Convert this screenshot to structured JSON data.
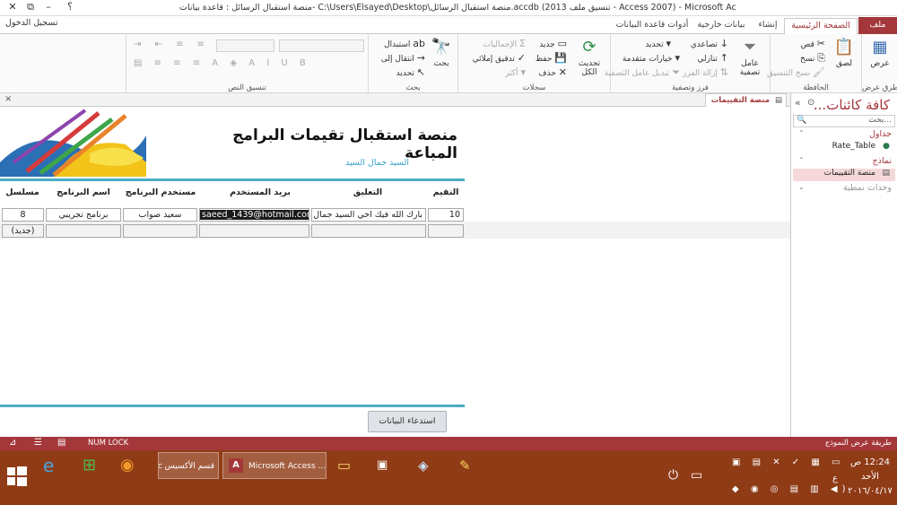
{
  "window": {
    "title": "منصة استقبال الرسائل : قاعدة بيانات- C:\\Users\\Elsayed\\Desktop\\منصة استقبال الرسائل.accdb (تنسيق ملف 2013 - Access 2007) - Microsoft Access",
    "help": "؟",
    "minimize": "–",
    "restore": "⧉",
    "close": "✕"
  },
  "signin": "تسجيل الدخول",
  "tabs": {
    "file": "ملف",
    "home": "الصفحة الرئيسية",
    "create": "إنشاء",
    "external": "بيانات خارجية",
    "dbtools": "أدوات قاعدة البيانات"
  },
  "ribbon": {
    "views": {
      "label": "طرق عرض",
      "view": "عرض"
    },
    "clipboard": {
      "label": "الحافظة",
      "paste": "لصق",
      "cut": "قص",
      "copy": "نسخ",
      "format_painter": "نسخ التنسيق"
    },
    "sort": {
      "label": "فرز وتصفية",
      "filter": "عامل تصفية",
      "asc": "تصاعدي",
      "desc": "تنازلي",
      "remove_sort": "إزالة الفرز",
      "selection": "تحديد",
      "advanced": "خيارات متقدمة",
      "toggle_filter": "تبديل عامل التصفية"
    },
    "records": {
      "label": "سجلات",
      "refresh": "تحديث الكل",
      "new": "جديد",
      "save": "حفظ",
      "delete": "حذف",
      "totals": "الإجماليات",
      "spelling": "تدقيق إملائي",
      "more": "أكثر"
    },
    "find": {
      "label": "بحث",
      "find": "بحث",
      "replace": "استبدال",
      "goto": "انتقال إلى",
      "select": "تحديد"
    },
    "text": {
      "label": "تنسيق النص"
    }
  },
  "nav": {
    "title": "كافة كائنات...",
    "search_placeholder": "بحث...",
    "cat_tables": "جداول",
    "table1": "Rate_Table",
    "cat_forms": "نماذج",
    "form1": "منصة التقييمات",
    "cat_modules": "وحدات نمطية"
  },
  "doc_tab": {
    "label": "منصة التقييمات",
    "close": "×"
  },
  "form": {
    "title": "منصة استقبال تقيمات البرامج المباعة",
    "subtitle": "السيد جمال السيد",
    "columns": {
      "rating": "التقيم",
      "comment": "التعليق",
      "email": "بريد المستخدم",
      "username": "مستخدم البرنامج",
      "program": "اسم البرنامج",
      "serial": "مسلسل"
    },
    "row": {
      "rating": "10",
      "comment": "بارك الله فيك اخي السيد جمال وزادك نجاحا",
      "email": "saeed_1439@hotmail.com",
      "username": "سعيد صواب",
      "program": "برنامج تجريبي",
      "serial": "8"
    },
    "new_label": "(جديد)",
    "button": "استدعاء البيانات"
  },
  "status": {
    "numlock": "NUM LOCK",
    "view_mode": "طريقة عرض النموذج"
  },
  "taskbar": {
    "app1": "قسم الأكسيس Acc...",
    "app2": "Microsoft Access ...",
    "time": "12:24 ص",
    "day": "الأحد",
    "date": "٢٠١٦/٠٤/١٧",
    "lang": "ع"
  },
  "colors": {
    "accent": "#a4373a",
    "taskbar": "#8f3b16",
    "form_line": "#4bacc6"
  }
}
